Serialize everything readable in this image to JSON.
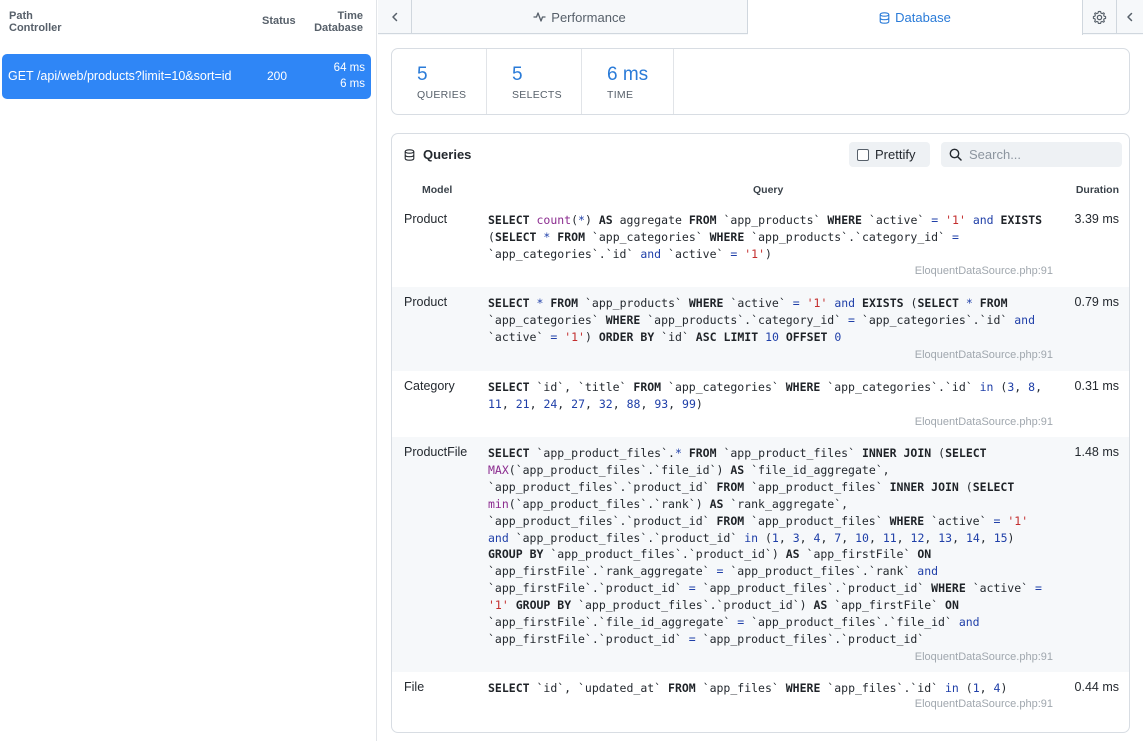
{
  "requests_header": {
    "path_label": "Path",
    "controller_label": "Controller",
    "status_label": "Status",
    "time_label": "Time",
    "database_label": "Database"
  },
  "request": {
    "method_path": "GET /api/web/products?limit=10&sort=id",
    "status": "200",
    "total_time": "64 ms",
    "db_time": "6 ms",
    "accent_color": "#2f86f6"
  },
  "tabs": {
    "performance": "Performance",
    "database": "Database",
    "active": "database",
    "icons": {
      "back": "chevron-left-icon",
      "performance": "activity-icon",
      "database": "database-icon",
      "settings": "gear-icon",
      "collapse": "chevron-left-icon"
    }
  },
  "stats": [
    {
      "value": "5",
      "label": "QUERIES"
    },
    {
      "value": "5",
      "label": "SELECTS"
    },
    {
      "value": "6 ms",
      "label": "TIME"
    }
  ],
  "queries_panel": {
    "title": "Queries",
    "prettify_label": "Prettify",
    "prettify_checked": false,
    "search_placeholder": "Search...",
    "search_value": "",
    "columns": {
      "model": "Model",
      "query": "Query",
      "duration": "Duration"
    }
  },
  "queries": [
    {
      "model": "Product",
      "sql": "SELECT count(*) AS aggregate FROM `app_products` WHERE `active` = '1' and EXISTS (SELECT * FROM `app_categories` WHERE `app_products`.`category_id` = `app_categories`.`id` and `active` = '1')",
      "duration": "3.39 ms",
      "source": "EloquentDataSource.php:91"
    },
    {
      "model": "Product",
      "sql": "SELECT * FROM `app_products` WHERE `active` = '1' and EXISTS (SELECT * FROM `app_categories` WHERE `app_products`.`category_id` = `app_categories`.`id` and `active` = '1') ORDER BY `id` ASC LIMIT 10 OFFSET 0",
      "duration": "0.79 ms",
      "source": "EloquentDataSource.php:91"
    },
    {
      "model": "Category",
      "sql": "SELECT `id`, `title` FROM `app_categories` WHERE `app_categories`.`id` in (3, 8, 11, 21, 24, 27, 32, 88, 93, 99)",
      "duration": "0.31 ms",
      "source": "EloquentDataSource.php:91"
    },
    {
      "model": "ProductFile",
      "sql": "SELECT `app_product_files`.* FROM `app_product_files` INNER JOIN (SELECT MAX(`app_product_files`.`file_id`) AS `file_id_aggregate`, `app_product_files`.`product_id` FROM `app_product_files` INNER JOIN (SELECT min(`app_product_files`.`rank`) AS `rank_aggregate`, `app_product_files`.`product_id` FROM `app_product_files` WHERE `active` = '1' and `app_product_files`.`product_id` in (1, 3, 4, 7, 10, 11, 12, 13, 14, 15) GROUP BY `app_product_files`.`product_id`) AS `app_firstFile` ON `app_firstFile`.`rank_aggregate` = `app_product_files`.`rank` and `app_firstFile`.`product_id` = `app_product_files`.`product_id` WHERE `active` = '1' GROUP BY `app_product_files`.`product_id`) AS `app_firstFile` ON `app_firstFile`.`file_id_aggregate` = `app_product_files`.`file_id` and `app_firstFile`.`product_id` = `app_product_files`.`product_id`",
      "duration": "1.48 ms",
      "source": "EloquentDataSource.php:91"
    },
    {
      "model": "File",
      "sql": "SELECT `id`, `updated_at` FROM `app_files` WHERE `app_files`.`id` in (1, 4)",
      "duration": "0.44 ms",
      "source": "EloquentDataSource.php:91"
    }
  ]
}
